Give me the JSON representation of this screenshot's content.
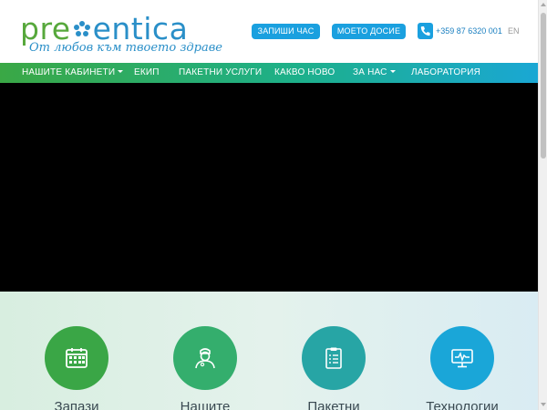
{
  "header": {
    "logo_prefix": "pre",
    "logo_suffix": "entica",
    "tagline": "От любов към твоето здраве",
    "book_button": "ЗАПИШИ ЧАС",
    "dossier_button": "МОЕТО ДОСИЕ",
    "phone": "+359 87 6320 001",
    "language": "EN"
  },
  "nav": {
    "items": [
      {
        "label": "НАШИТЕ КАБИНЕТИ",
        "dropdown": true
      },
      {
        "label": "ЕКИП",
        "dropdown": false
      },
      {
        "label": "ПАКЕТНИ УСЛУГИ",
        "dropdown": false
      },
      {
        "label": "КАКВО НОВО",
        "dropdown": false
      },
      {
        "label": "ЗА НАС",
        "dropdown": true
      },
      {
        "label": "ЛАБОРАТОРИЯ",
        "dropdown": false
      }
    ]
  },
  "features": [
    {
      "icon": "calendar-icon",
      "label": "Запази",
      "color": "#3aa646"
    },
    {
      "icon": "doctor-icon",
      "label": "Нашите",
      "color": "#34ae6d"
    },
    {
      "icon": "checklist-icon",
      "label": "Пакетни",
      "color": "#27a5a5"
    },
    {
      "icon": "monitor-icon",
      "label": "Технологии",
      "color": "#1aa6d8"
    }
  ],
  "colors": {
    "brand_blue": "#1aa0df",
    "brand_green": "#57a83c",
    "hero_background": "#000000"
  }
}
